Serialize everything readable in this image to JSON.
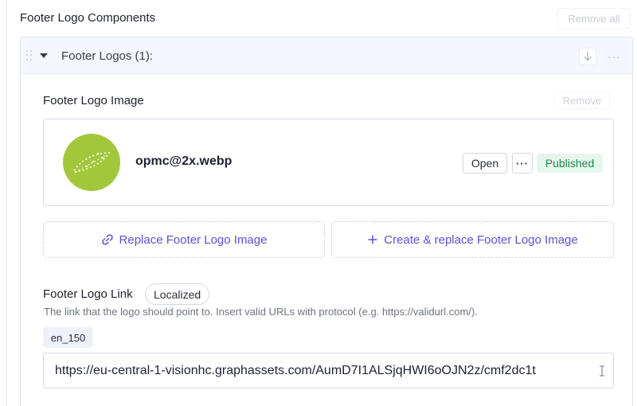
{
  "section": {
    "title": "Footer Logo Components",
    "remove_all_label": "Remove all"
  },
  "group": {
    "label": "Footer Logos (1):",
    "more_label": "···"
  },
  "logo_image": {
    "title": "Footer Logo Image",
    "remove_label": "Remove",
    "asset": {
      "file_name": "opmc@2x.webp",
      "open_label": "Open",
      "more_label": "···",
      "status": "Published",
      "thumb_color": "#a3c73b"
    },
    "replace_label": "Replace Footer Logo Image",
    "create_label": "Create & replace Footer Logo Image"
  },
  "logo_link": {
    "title": "Footer Logo Link",
    "badge": "Localized",
    "help": "The link that the logo should point to. Insert valid URLs with protocol (e.g. https://validurl.com/).",
    "locale": "en_150",
    "value": "https://eu-central-1-visionhc.graphassets.com/AumD7I1ALSjqHWI6oOJN2z/cmf2dc1t"
  },
  "colors": {
    "accent": "#5b51d8",
    "published_bg": "#e6f6ec",
    "published_text": "#1c8a4c"
  }
}
